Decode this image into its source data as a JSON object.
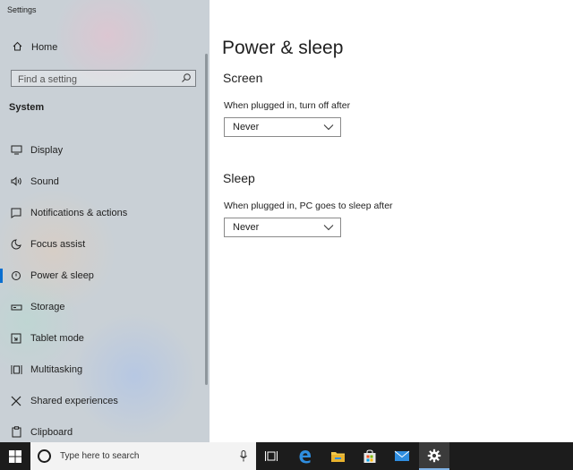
{
  "window": {
    "title": "Settings"
  },
  "sidebar": {
    "home_label": "Home",
    "search_placeholder": "Find a setting",
    "section_label": "System",
    "items": [
      {
        "label": "Display",
        "icon": "display-icon"
      },
      {
        "label": "Sound",
        "icon": "sound-icon"
      },
      {
        "label": "Notifications & actions",
        "icon": "notifications-icon"
      },
      {
        "label": "Focus assist",
        "icon": "moon-icon"
      },
      {
        "label": "Power & sleep",
        "icon": "power-icon",
        "selected": true
      },
      {
        "label": "Storage",
        "icon": "storage-icon"
      },
      {
        "label": "Tablet mode",
        "icon": "tablet-icon"
      },
      {
        "label": "Multitasking",
        "icon": "multitasking-icon"
      },
      {
        "label": "Shared experiences",
        "icon": "shared-experiences-icon"
      },
      {
        "label": "Clipboard",
        "icon": "clipboard-icon"
      }
    ]
  },
  "main": {
    "title": "Power & sleep",
    "screen": {
      "heading": "Screen",
      "label": "When plugged in, turn off after",
      "value": "Never"
    },
    "sleep": {
      "heading": "Sleep",
      "label": "When plugged in, PC goes to sleep after",
      "value": "Never"
    }
  },
  "taskbar": {
    "search_placeholder": "Type here to search",
    "accent": "#7fb2e5",
    "apps": [
      "task-view-icon",
      "edge-icon",
      "file-explorer-icon",
      "store-icon",
      "mail-icon",
      "settings-gear-icon"
    ]
  }
}
